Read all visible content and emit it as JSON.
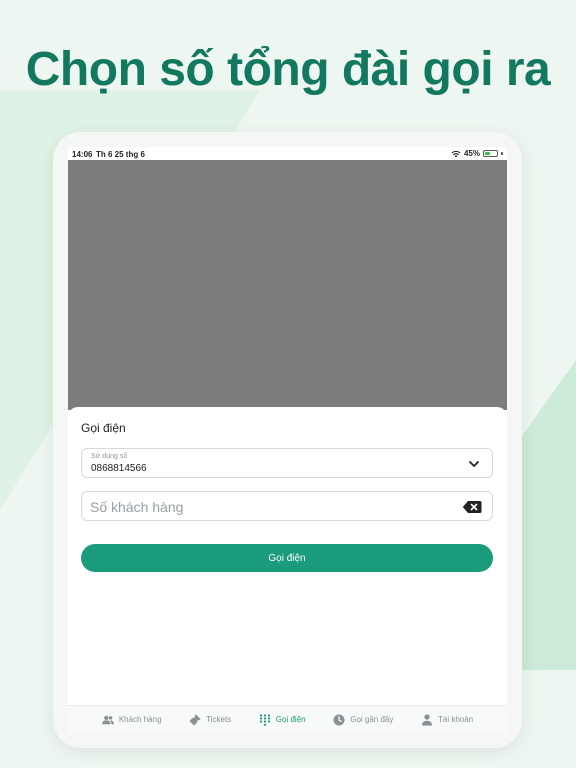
{
  "headline": "Chọn số tổng đài gọi ra",
  "status_bar": {
    "time": "14:06",
    "date": "Th 6 25 thg 6",
    "battery": "45%",
    "battery_level": 0.45
  },
  "dialog": {
    "title": "Gọi điện",
    "line_select": {
      "label": "Sử dụng số",
      "value": "0868814566"
    },
    "customer_input": {
      "placeholder": "Số khách hàng",
      "value": ""
    },
    "call_button_label": "Gọi điện"
  },
  "tabs": [
    {
      "label": "Khách hàng",
      "icon": "people-icon",
      "active": false
    },
    {
      "label": "Tickets",
      "icon": "ticket-icon",
      "active": false
    },
    {
      "label": "Gọi điện",
      "icon": "dialpad-icon",
      "active": true
    },
    {
      "label": "Gọi gần đây",
      "icon": "clock-icon",
      "active": false
    },
    {
      "label": "Tài khoản",
      "icon": "person-icon",
      "active": false
    }
  ],
  "colors": {
    "accent": "#199b7c",
    "headline": "#12785e",
    "overlay": "#7b7c7e",
    "inactive_tab": "#8a9095"
  }
}
